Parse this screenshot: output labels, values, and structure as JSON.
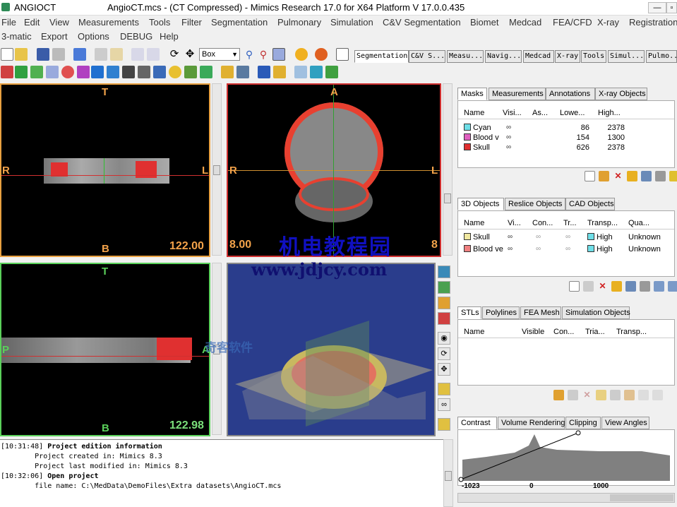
{
  "window": {
    "app_name": "ANGIOCT",
    "title": "AngioCT.mcs - (CT Compressed) - Mimics Research 17.0 for X64 Platform V 17.0.0.435",
    "min_label": "—",
    "max_label": "▫"
  },
  "menu_row1": [
    "File",
    "Edit",
    "View",
    "Measurements",
    "Tools",
    "Filter",
    "Segmentation",
    "Pulmonary",
    "Simulation",
    "C&V Segmentation",
    "Biomet",
    "Medcad",
    "FEA/CFD",
    "X-ray",
    "Registration"
  ],
  "menu_row2": [
    "3-matic",
    "Export",
    "Options",
    "DEBUG",
    "Help"
  ],
  "toolbar": {
    "box_select": "Box"
  },
  "main_tabs": [
    "Segmentation",
    "C&V S...",
    "Measu...",
    "Navig...",
    "Medcad",
    "X-ray",
    "Tools",
    "Simul...",
    "Pulmo..."
  ],
  "views": {
    "axial_label_top": "T",
    "axial_label_left": "R",
    "axial_label_right": "L",
    "axial_label_bottom": "B",
    "axial_slice": "122.00",
    "coronal_label_top": "A",
    "coronal_label_left": "R",
    "coronal_label_right": "L",
    "coronal_slice_left": "8.00",
    "coronal_slice_right": "8",
    "sagittal_label_top": "T",
    "sagittal_label_left": "P",
    "sagittal_label_right": "A",
    "sagittal_label_bottom": "B",
    "sagittal_slice": "122.98"
  },
  "watermark": {
    "line1": "机电教程园",
    "line2": "www.jdjcy.com",
    "line3": "奇客软件"
  },
  "masks_panel": {
    "tabs": [
      "Masks",
      "Measurements",
      "Annotations",
      "X-ray Objects"
    ],
    "headers": [
      "Name",
      "Visi...",
      "As...",
      "Lowe...",
      "High..."
    ],
    "rows": [
      {
        "name": "Cyan",
        "color": "#6fdfe8",
        "low": "86",
        "high": "2378"
      },
      {
        "name": "Blood v",
        "color": "#e060c0",
        "low": "154",
        "high": "1300"
      },
      {
        "name": "Skull",
        "color": "#e03030",
        "low": "626",
        "high": "2378"
      }
    ]
  },
  "objects3d_panel": {
    "tabs": [
      "3D Objects",
      "Reslice Objects",
      "CAD Objects"
    ],
    "headers": [
      "Name",
      "Vi...",
      "Con...",
      "Tr...",
      "Transp...",
      "Qua..."
    ],
    "rows": [
      {
        "name": "Skull",
        "color": "#f0e8a0",
        "transp": "High",
        "quality": "Unknown"
      },
      {
        "name": "Blood ve",
        "color": "#f08080",
        "transp": "High",
        "quality": "Unknown"
      }
    ]
  },
  "stl_panel": {
    "tabs": [
      "STLs",
      "Polylines",
      "FEA Mesh",
      "Simulation Objects"
    ],
    "headers": [
      "Name",
      "Visible",
      "Con...",
      "Tria...",
      "Transp..."
    ]
  },
  "contrast_panel": {
    "tabs": [
      "Contrast",
      "Volume Rendering",
      "Clipping",
      "View Angles"
    ],
    "axis_ticks": [
      "-1023",
      "0",
      "1000"
    ]
  },
  "log": [
    {
      "time": "[10:31:48]",
      "title": "Project edition information"
    },
    {
      "text": "        Project created in: Mimics 8.3"
    },
    {
      "text": "        Project last modified in: Mimics 8.3"
    },
    {
      "time": "[10:32:06]",
      "title": "Open project"
    },
    {
      "text": "        file name: C:\\MedData\\DemoFiles\\Extra datasets\\AngioCT.mcs"
    }
  ]
}
